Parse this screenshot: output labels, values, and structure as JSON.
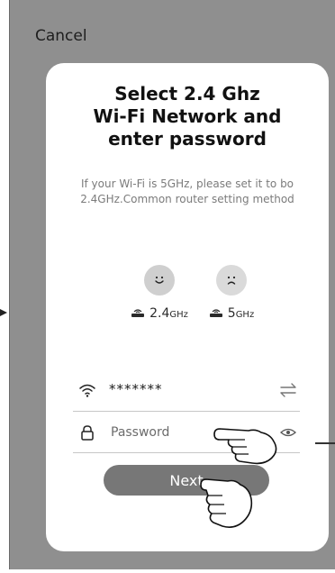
{
  "header": {
    "cancel_label": "Cancel"
  },
  "card": {
    "title_lines": [
      "Select 2.4 Ghz",
      "Wi-Fi Network and",
      "enter password"
    ],
    "hint": "If your Wi-Fi is 5GHz, please set it to bo 2.4GHz.Common router setting method"
  },
  "bands": [
    {
      "number": "2.4",
      "unit": "GHz",
      "face": "happy-face-icon"
    },
    {
      "number": "5",
      "unit": "GHz",
      "face": "sad-face-icon"
    }
  ],
  "wifi": {
    "ssid": "*******",
    "icon": "wifi-icon",
    "switch_icon": "swap-icon"
  },
  "password": {
    "placeholder": "Password",
    "value": "",
    "icon": "lock-icon",
    "toggle_icon": "eye-icon"
  },
  "next_label": "Next",
  "colors": {
    "backdrop": "#8f8f8f",
    "button": "#777777",
    "card": "#ffffff"
  }
}
